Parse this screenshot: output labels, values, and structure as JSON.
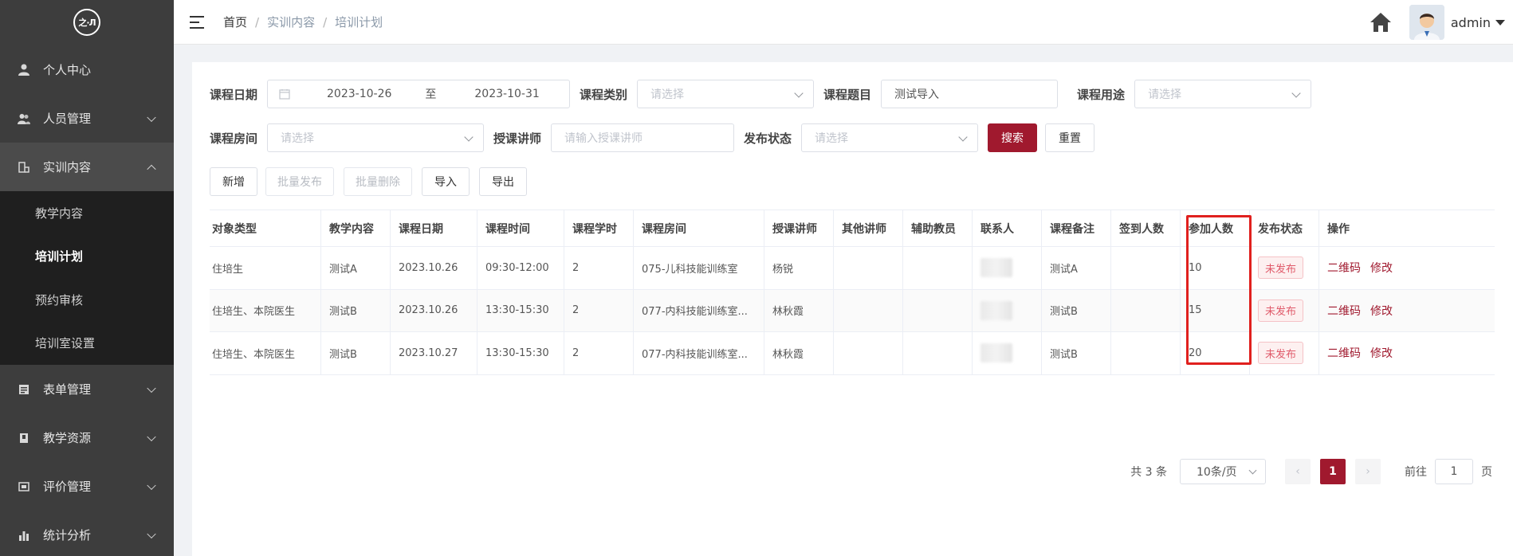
{
  "sidebar": {
    "logo_text": "之·Л",
    "items": [
      {
        "label": "个人中心",
        "icon": "user-icon"
      },
      {
        "label": "人员管理",
        "icon": "users-icon"
      },
      {
        "label": "实训内容",
        "icon": "content-icon"
      },
      {
        "label": "表单管理",
        "icon": "form-icon"
      },
      {
        "label": "教学资源",
        "icon": "book-icon"
      },
      {
        "label": "评价管理",
        "icon": "evaluate-icon"
      },
      {
        "label": "统计分析",
        "icon": "chart-icon"
      }
    ],
    "sub_items": [
      {
        "label": "教学内容"
      },
      {
        "label": "培训计划"
      },
      {
        "label": "预约审核"
      },
      {
        "label": "培训室设置"
      }
    ]
  },
  "header": {
    "breadcrumb": [
      "首页",
      "实训内容",
      "培训计划"
    ],
    "separator": "/",
    "user": "admin"
  },
  "filters": {
    "date_label": "课程日期",
    "date_start": "2023-10-26",
    "date_to": "至",
    "date_end": "2023-10-31",
    "category_label": "课程类别",
    "category_placeholder": "请选择",
    "topic_label": "课程题目",
    "topic_value": "测试导入",
    "usage_label": "课程用途",
    "usage_placeholder": "请选择",
    "room_label": "课程房间",
    "room_placeholder": "请选择",
    "teacher_label": "授课讲师",
    "teacher_placeholder": "请输入授课讲师",
    "status_label": "发布状态",
    "status_placeholder": "请选择",
    "search_btn": "搜索",
    "reset_btn": "重置"
  },
  "toolbar": {
    "add": "新增",
    "batch_publish": "批量发布",
    "batch_delete": "批量删除",
    "import": "导入",
    "export": "导出"
  },
  "table": {
    "columns": [
      "对象类型",
      "教学内容",
      "课程日期",
      "课程时间",
      "课程学时",
      "课程房间",
      "授课讲师",
      "其他讲师",
      "辅助教员",
      "联系人",
      "课程备注",
      "签到人数",
      "参加人数",
      "发布状态",
      "操作"
    ],
    "rows": [
      {
        "type": "住培生",
        "content": "测试A",
        "date": "2023.10.26",
        "time": "09:30-12:00",
        "hours": "2",
        "room": "075-儿科技能训练室",
        "teacher": "杨锐",
        "other": "",
        "assist": "",
        "remark": "测试A",
        "signin": "",
        "attend": "10",
        "status": "未发布",
        "op_qr": "二维码",
        "op_edit": "修改"
      },
      {
        "type": "住培生、本院医生",
        "content": "测试B",
        "date": "2023.10.26",
        "time": "13:30-15:30",
        "hours": "2",
        "room": "077-内科技能训练室...",
        "teacher": "林秋霞",
        "other": "",
        "assist": "",
        "remark": "测试B",
        "signin": "",
        "attend": "15",
        "status": "未发布",
        "op_qr": "二维码",
        "op_edit": "修改"
      },
      {
        "type": "住培生、本院医生",
        "content": "测试B",
        "date": "2023.10.27",
        "time": "13:30-15:30",
        "hours": "2",
        "room": "077-内科技能训练室...",
        "teacher": "林秋霞",
        "other": "",
        "assist": "",
        "remark": "测试B",
        "signin": "",
        "attend": "20",
        "status": "未发布",
        "op_qr": "二维码",
        "op_edit": "修改"
      }
    ]
  },
  "pagination": {
    "total": "共 3 条",
    "page_size": "10条/页",
    "current": "1",
    "goto_label": "前往",
    "goto_value": "1",
    "page_suffix": "页",
    "prev": "‹",
    "next": "›"
  },
  "colors": {
    "primary": "#a0192e",
    "sidebar_bg": "#3d3d3d",
    "submenu_bg": "#1f1f1f",
    "highlight_border": "#e0201e"
  }
}
